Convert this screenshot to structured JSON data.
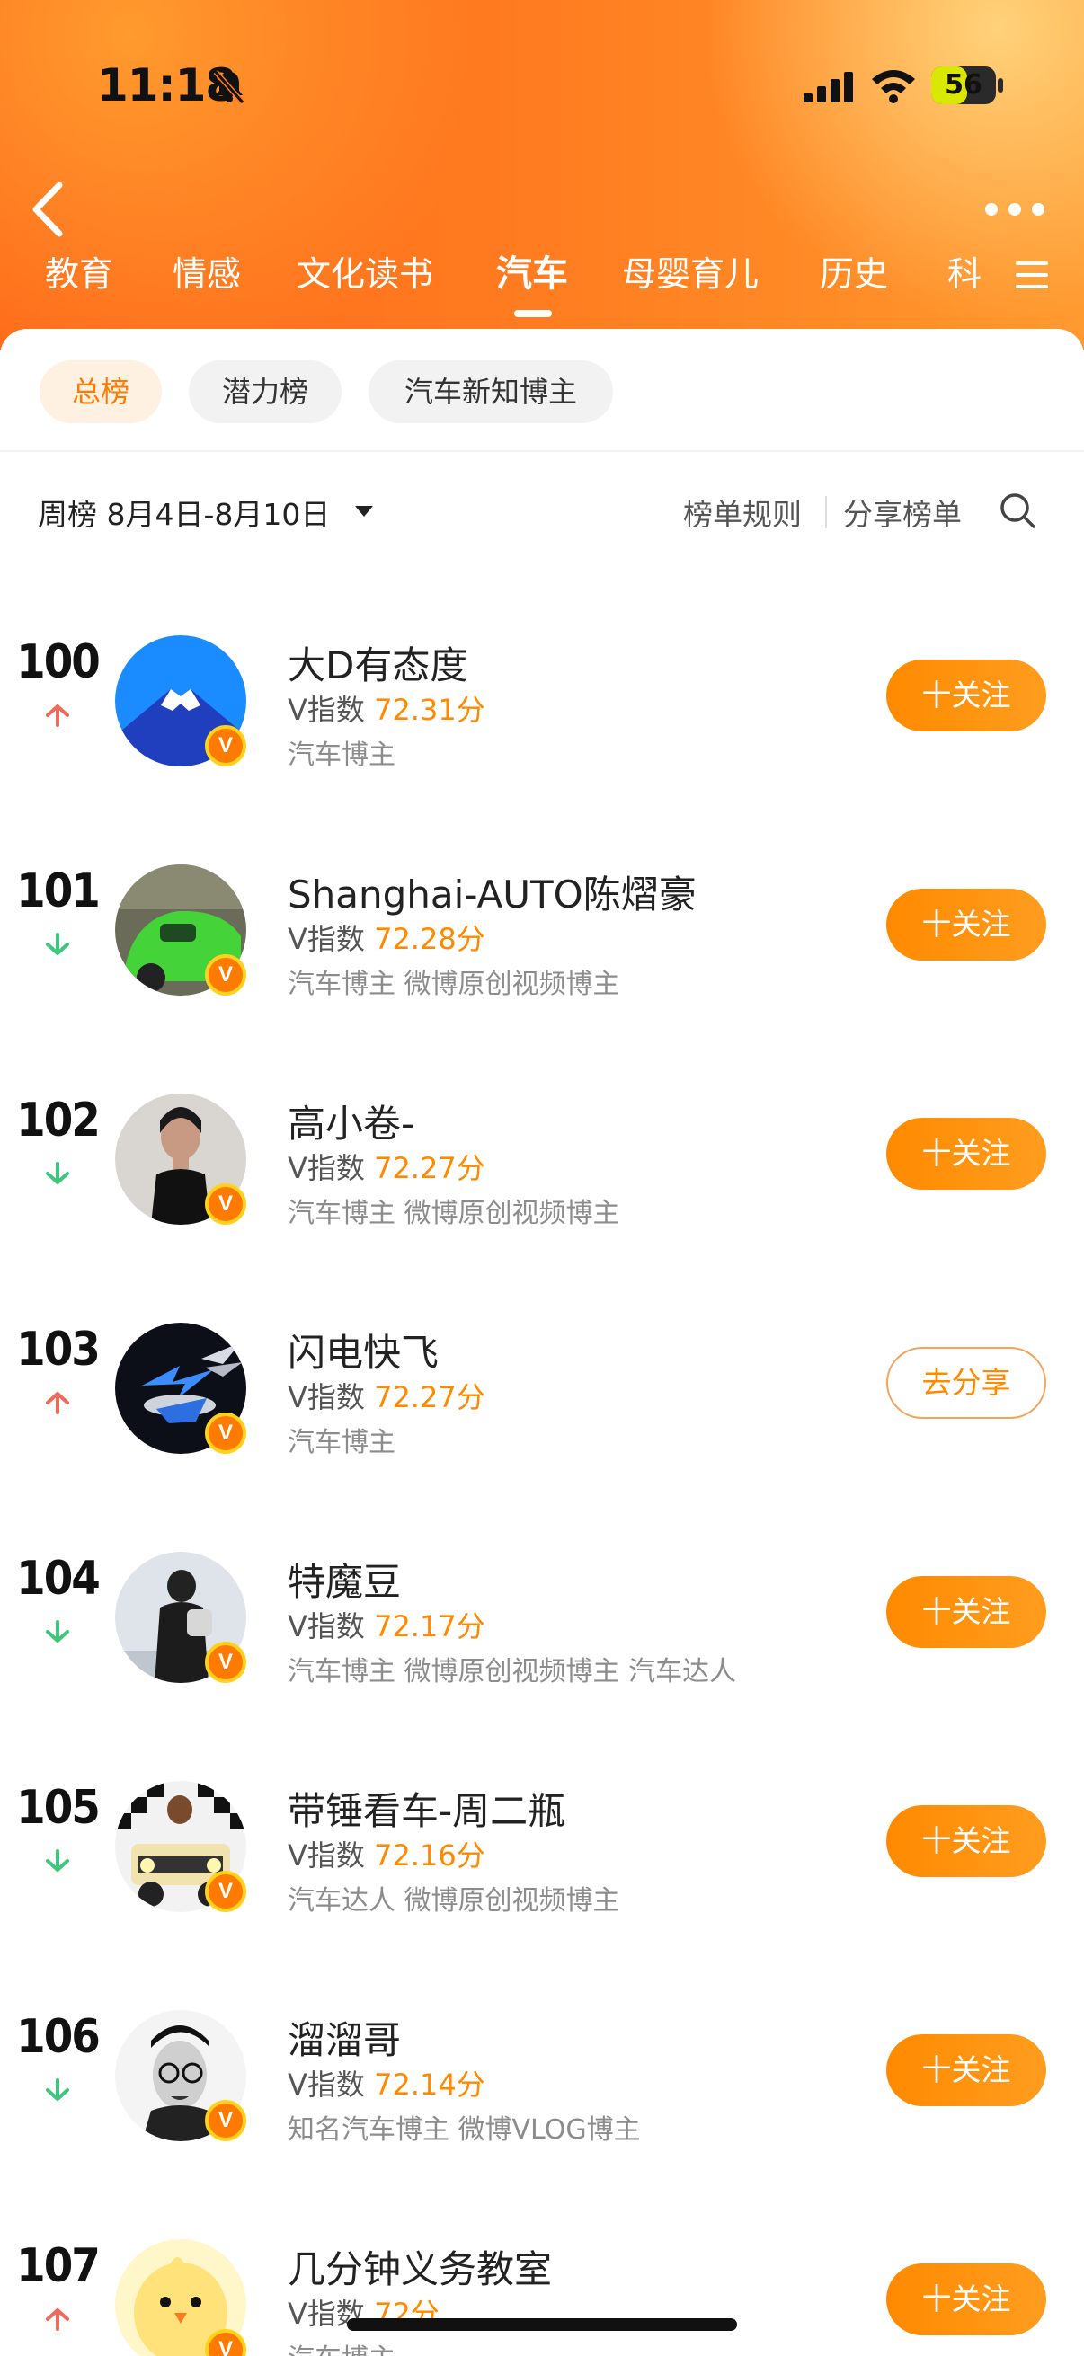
{
  "status_bar": {
    "time": "11:18",
    "battery": "56"
  },
  "tabs": [
    {
      "label": "教育"
    },
    {
      "label": "情感"
    },
    {
      "label": "文化读书"
    },
    {
      "label": "汽车"
    },
    {
      "label": "母婴育儿"
    },
    {
      "label": "历史"
    },
    {
      "label": "科"
    }
  ],
  "active_tab_index": 3,
  "subtabs": [
    {
      "label": "总榜"
    },
    {
      "label": "潜力榜"
    },
    {
      "label": "汽车新知博主"
    }
  ],
  "week": {
    "label": "周榜 8月4日-8月10日"
  },
  "actions": {
    "rules": "榜单规则",
    "share_list": "分享榜单"
  },
  "labels": {
    "vindex_prefix": "V指数 ",
    "follow": "十关注",
    "share": "去分享",
    "v_badge": "V"
  },
  "colors": {
    "accent": "#ff8a00",
    "up": "#f06a5a",
    "down": "#3cc77c"
  },
  "rows": [
    {
      "rank": "100",
      "trend": "up",
      "name": "大D有态度",
      "score": "72.31分",
      "tags": "汽车博主",
      "action": "follow"
    },
    {
      "rank": "101",
      "trend": "down",
      "name": "Shanghai-AUTO陈熠豪",
      "score": "72.28分",
      "tags": "汽车博主 微博原创视频博主",
      "action": "follow"
    },
    {
      "rank": "102",
      "trend": "down",
      "name": "高小卷-",
      "score": "72.27分",
      "tags": "汽车博主 微博原创视频博主",
      "action": "follow"
    },
    {
      "rank": "103",
      "trend": "up",
      "name": "闪电快飞",
      "score": "72.27分",
      "tags": "汽车博主",
      "action": "share"
    },
    {
      "rank": "104",
      "trend": "down",
      "name": "特魔豆",
      "score": "72.17分",
      "tags": "汽车博主 微博原创视频博主 汽车达人",
      "action": "follow"
    },
    {
      "rank": "105",
      "trend": "down",
      "name": "带锤看车-周二瓶",
      "score": "72.16分",
      "tags": "汽车达人 微博原创视频博主",
      "action": "follow"
    },
    {
      "rank": "106",
      "trend": "down",
      "name": "溜溜哥",
      "score": "72.14分",
      "tags": "知名汽车博主 微博VLOG博主",
      "action": "follow"
    },
    {
      "rank": "107",
      "trend": "up",
      "name": "几分钟义务教室",
      "score": "72分",
      "tags": "汽车博主",
      "action": "follow"
    }
  ]
}
